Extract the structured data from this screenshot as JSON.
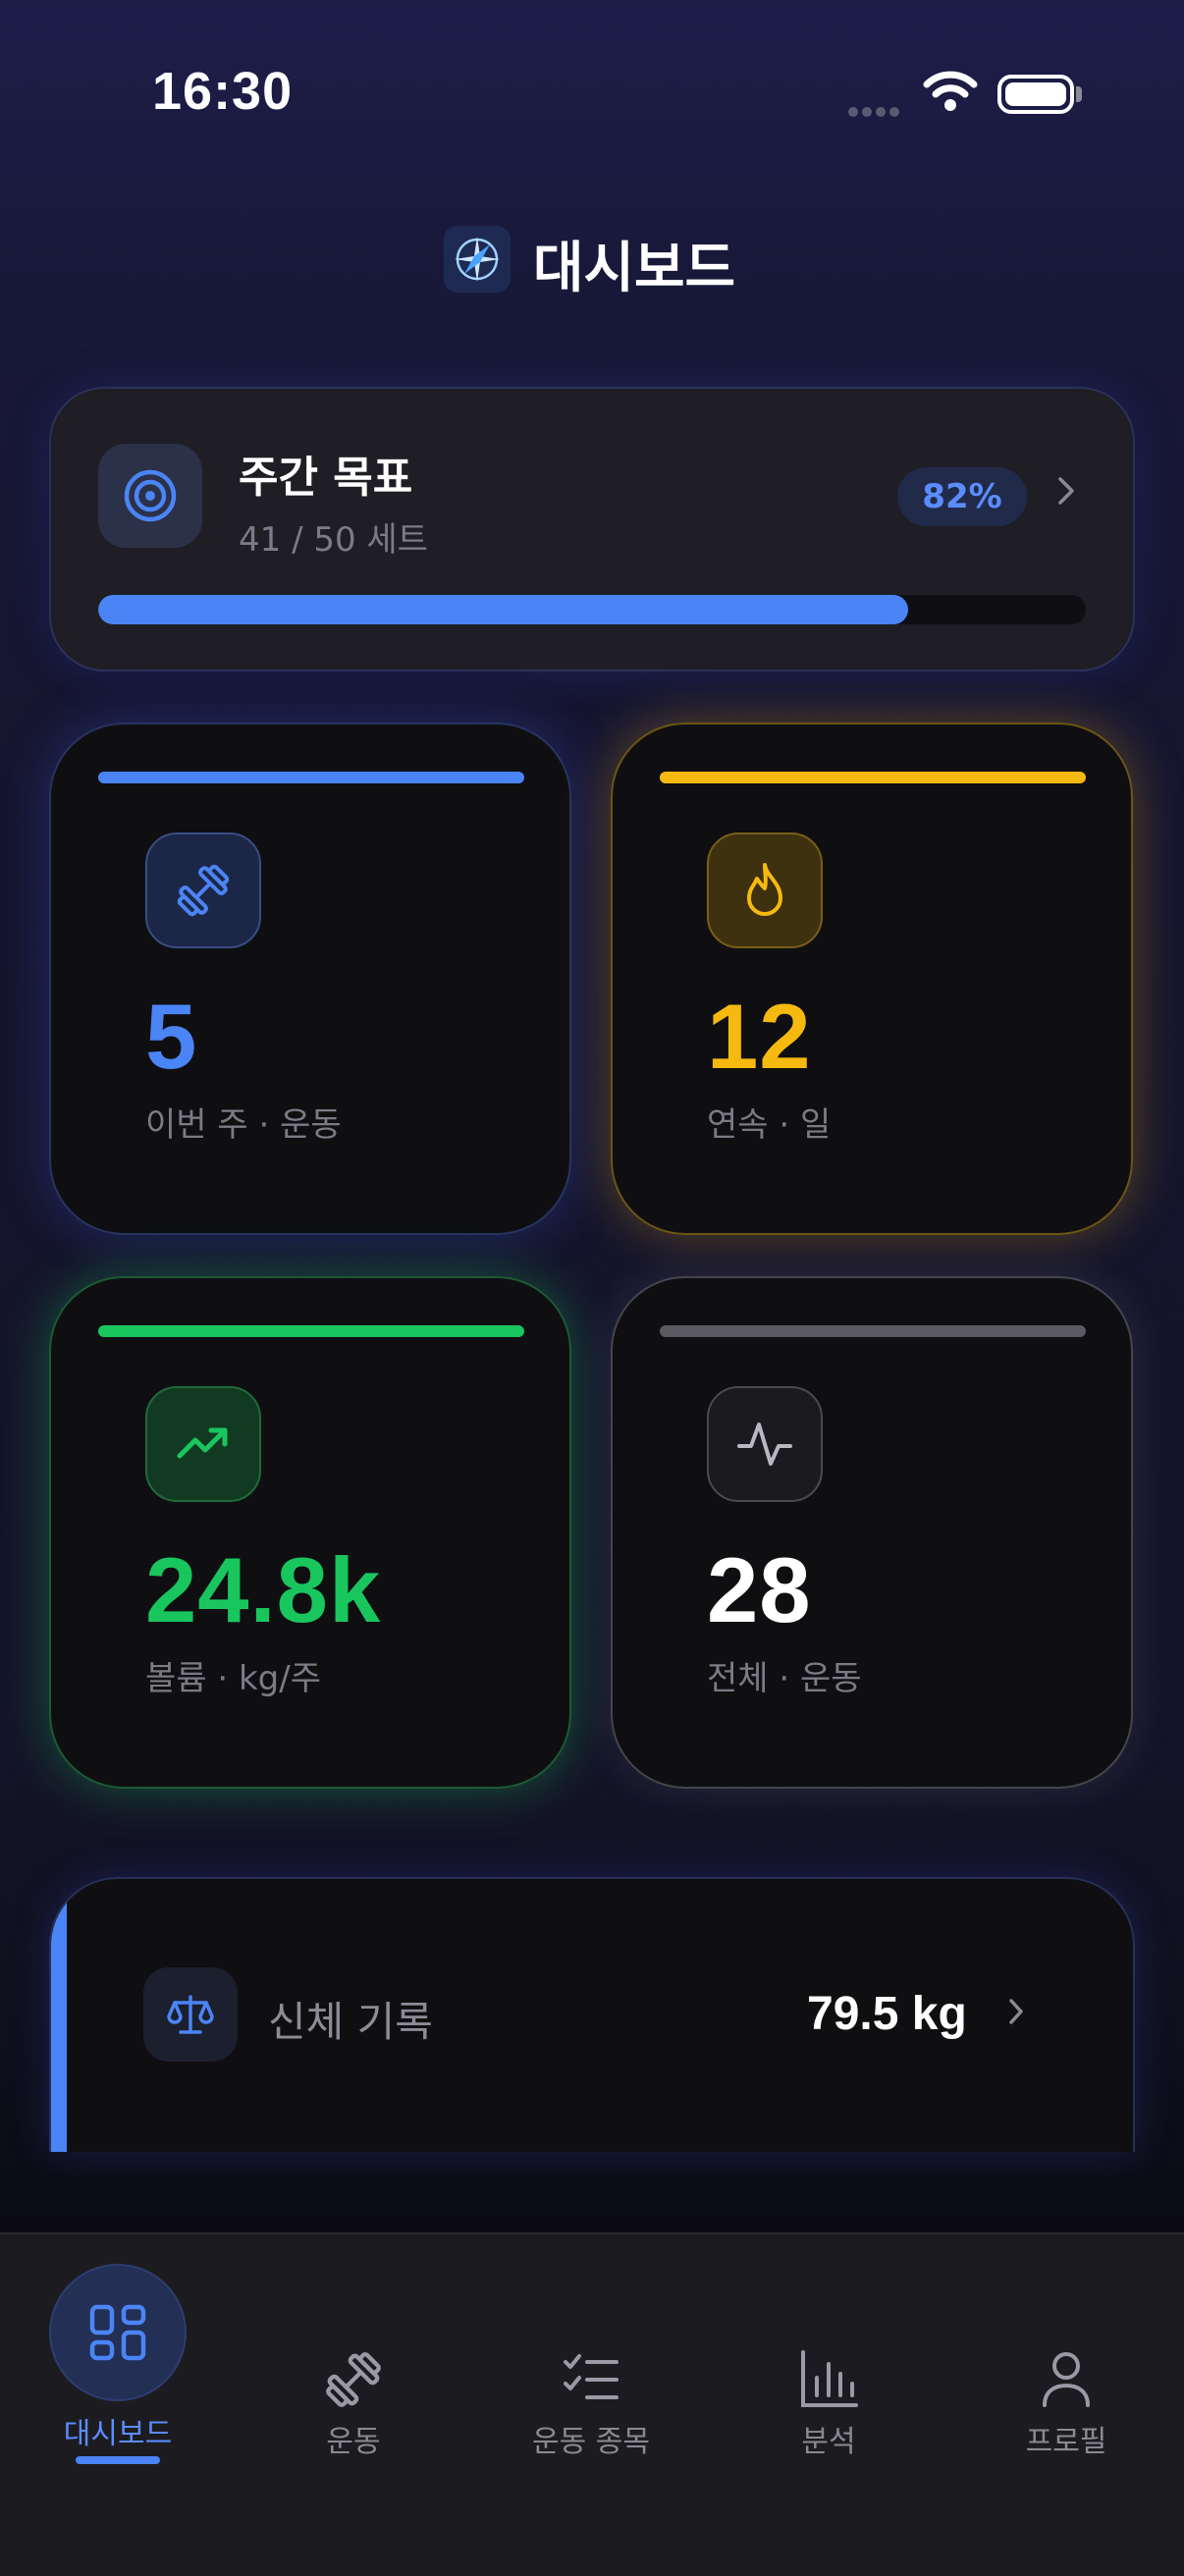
{
  "status_bar": {
    "time": "16:30"
  },
  "header": {
    "title": "대시보드",
    "logo_icon": "compass-icon"
  },
  "weekly_goal": {
    "title": "주간 목표",
    "subtitle": "41 / 50 세트",
    "percent_label": "82%",
    "progress": 0.82,
    "icon": "target-icon"
  },
  "stats": [
    {
      "value": "5",
      "label": "이번 주 · 운동",
      "color": "#4b84f5",
      "icon": "dumbbell-icon"
    },
    {
      "value": "12",
      "label": "연속 · 일",
      "color": "#f6b90f",
      "icon": "flame-icon"
    },
    {
      "value": "24.8k",
      "label": "볼륨 · kg/주",
      "color": "#19c65e",
      "icon": "trending-up-icon"
    },
    {
      "value": "28",
      "label": "전체 · 운동",
      "color": "#ffffff",
      "icon": "activity-icon"
    }
  ],
  "body_record": {
    "label": "신체 기록",
    "value": "79.5 kg",
    "icon": "scale-icon"
  },
  "tabbar": {
    "items": [
      {
        "label": "대시보드",
        "icon": "dashboard-icon",
        "active": true
      },
      {
        "label": "운동",
        "icon": "dumbbell-icon",
        "active": false
      },
      {
        "label": "운동 종목",
        "icon": "checklist-icon",
        "active": false
      },
      {
        "label": "분석",
        "icon": "bar-chart-icon",
        "active": false
      },
      {
        "label": "프로필",
        "icon": "user-icon",
        "active": false
      }
    ]
  },
  "colors": {
    "accent": "#4b84f5",
    "gold": "#f6b90f",
    "green": "#19c65e"
  }
}
